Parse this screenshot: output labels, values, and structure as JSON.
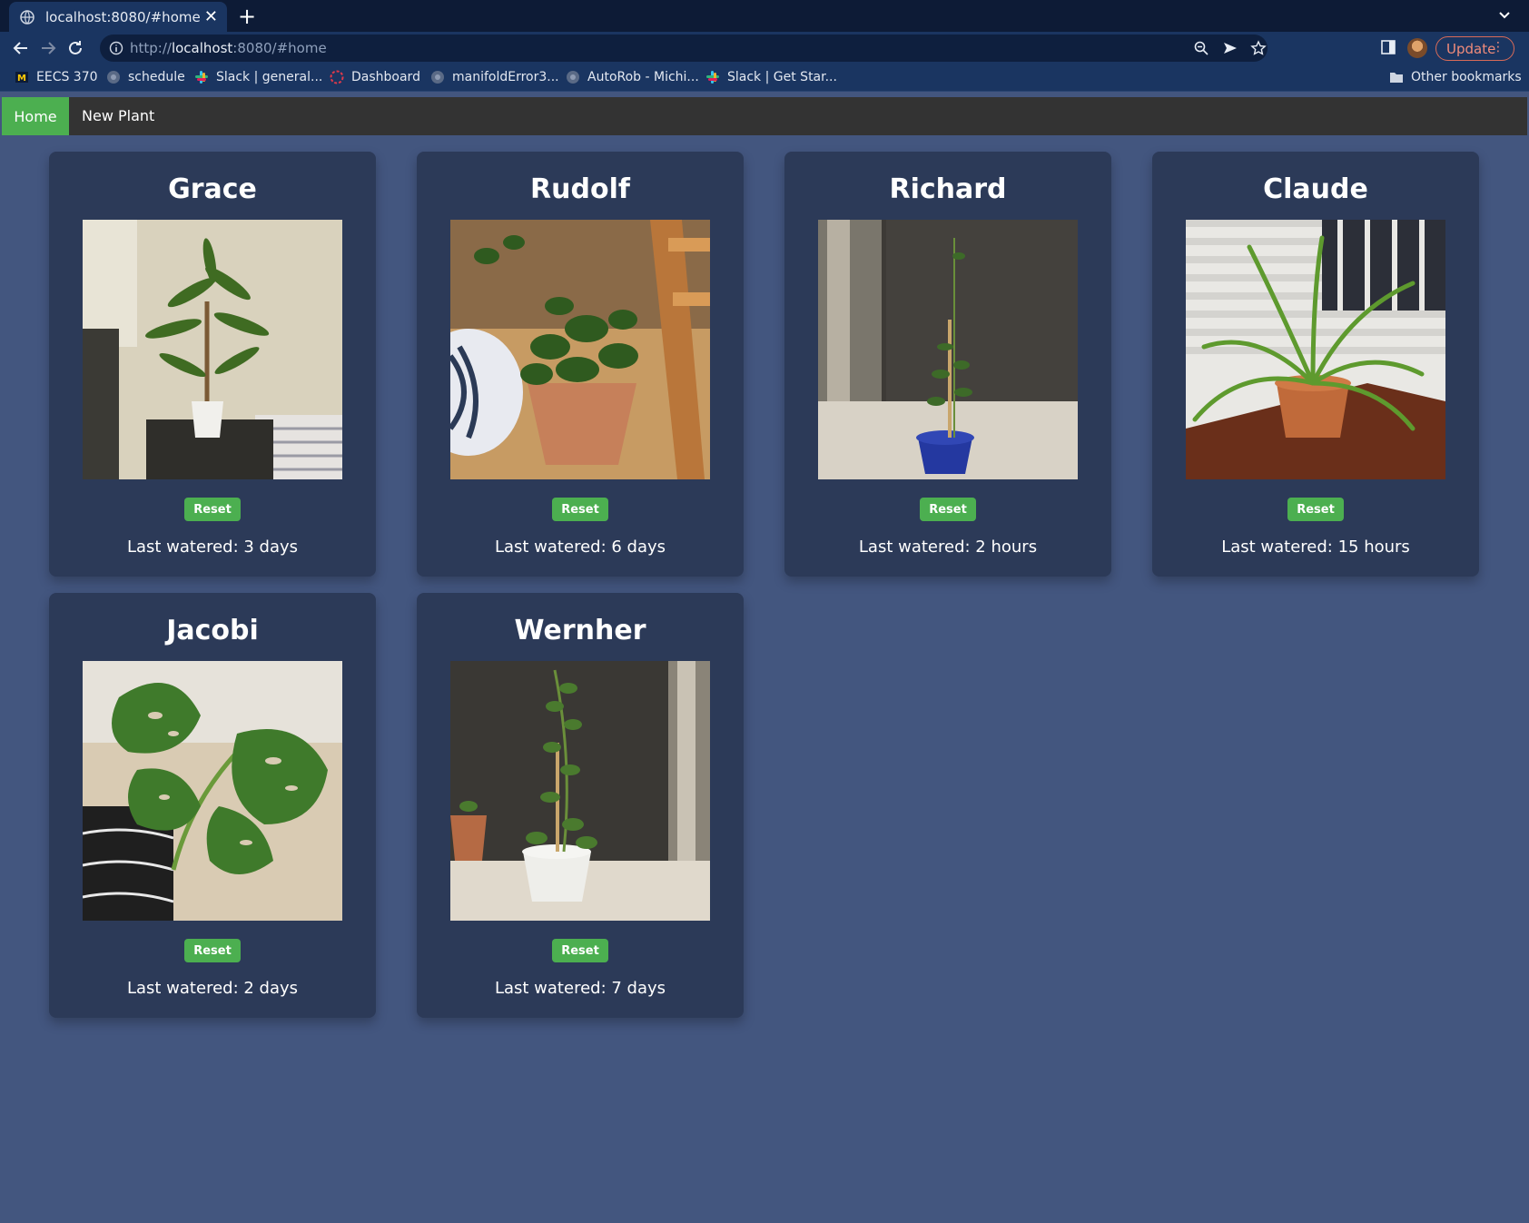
{
  "browser": {
    "tab_title": "localhost:8080/#home",
    "url_scheme": "http://",
    "url_host": "localhost",
    "url_rest": ":8080/#home",
    "update_label": "Update"
  },
  "bookmarks": [
    {
      "label": "EECS 370",
      "icon": "michigan-icon"
    },
    {
      "label": "schedule",
      "icon": "globe-icon"
    },
    {
      "label": "Slack | general...",
      "icon": "slack-icon"
    },
    {
      "label": "Dashboard",
      "icon": "dashboard-icon"
    },
    {
      "label": "manifoldError3...",
      "icon": "globe-icon"
    },
    {
      "label": "AutoRob - Michi...",
      "icon": "globe-icon"
    },
    {
      "label": "Slack | Get Star...",
      "icon": "slack-icon"
    }
  ],
  "other_bookmarks": "Other bookmarks",
  "nav": {
    "home": "Home",
    "new_plant": "New Plant",
    "active_color": "#4caf50"
  },
  "plants": [
    {
      "name": "Grace",
      "reset": "Reset",
      "watered": "Last watered: 3 days"
    },
    {
      "name": "Rudolf",
      "reset": "Reset",
      "watered": "Last watered: 6 days"
    },
    {
      "name": "Richard",
      "reset": "Reset",
      "watered": "Last watered: 2 hours"
    },
    {
      "name": "Claude",
      "reset": "Reset",
      "watered": "Last watered: 15 hours"
    },
    {
      "name": "Jacobi",
      "reset": "Reset",
      "watered": "Last watered: 2 days"
    },
    {
      "name": "Wernher",
      "reset": "Reset",
      "watered": "Last watered: 7 days"
    }
  ],
  "colors": {
    "page_bg": "#43567f",
    "card_bg": "#2c3a58",
    "button_green": "#4caf50"
  }
}
